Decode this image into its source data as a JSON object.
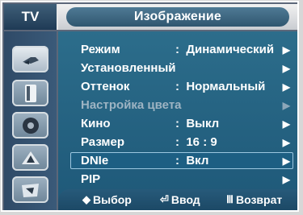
{
  "header": {
    "left_label": "TV",
    "title": "Изображение"
  },
  "sidebar": {
    "items": [
      {
        "icon": "antenna-icon",
        "active": true
      },
      {
        "icon": "speaker-icon",
        "active": false
      },
      {
        "icon": "disc-icon",
        "active": false
      },
      {
        "icon": "settings-tile-icon",
        "active": false
      },
      {
        "icon": "input-tile-icon",
        "active": false
      }
    ]
  },
  "menu": {
    "rows": [
      {
        "label": "Режим",
        "sep": ":",
        "value": "Динамический",
        "arrow": "▶",
        "state": "normal"
      },
      {
        "label": "Установленный",
        "sep": "",
        "value": "",
        "arrow": "▶",
        "state": "normal"
      },
      {
        "label": "Оттенок",
        "sep": ":",
        "value": "Нормальный",
        "arrow": "▶",
        "state": "normal"
      },
      {
        "label": "Настройка цвета",
        "sep": "",
        "value": "",
        "arrow": "▶",
        "state": "disabled"
      },
      {
        "label": "Кино",
        "sep": ":",
        "value": "Выкл",
        "arrow": "▶",
        "state": "normal"
      },
      {
        "label": "Размер",
        "sep": ":",
        "value": "16 : 9",
        "arrow": "▶",
        "state": "normal"
      },
      {
        "label": "DNIe",
        "sep": ":",
        "value": "Вкл",
        "arrow": "▶",
        "state": "selected"
      },
      {
        "label": "PIP",
        "sep": "",
        "value": "",
        "arrow": "▶",
        "state": "normal"
      }
    ]
  },
  "footer": {
    "select_icon": "◆",
    "select_label": "Выбор",
    "enter_icon": "⏎",
    "enter_label": "Ввод",
    "back_icon": "Ⅲ",
    "back_label": "Возврат"
  }
}
